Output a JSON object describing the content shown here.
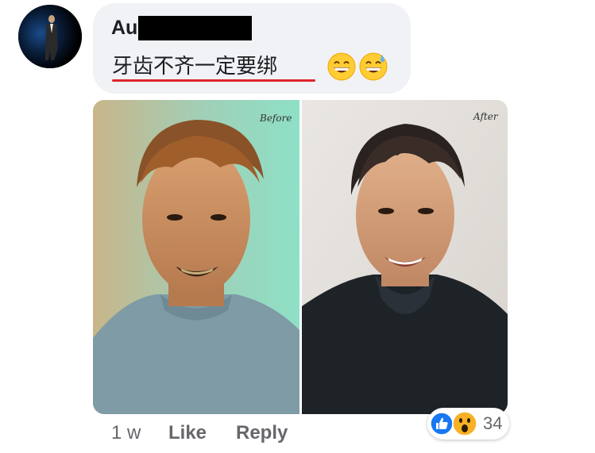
{
  "comment": {
    "author_visible": "Au",
    "text": "牙齿不齐一定要绑",
    "emojis": [
      "grinning-face-with-smiling-eyes",
      "grinning-face-with-sweat"
    ]
  },
  "photo": {
    "left_label": "Before",
    "right_label": "After"
  },
  "footer": {
    "time": "1 w",
    "like": "Like",
    "reply": "Reply"
  },
  "reactions": {
    "types": [
      "like",
      "wow"
    ],
    "count": "34",
    "colors": {
      "like": "#1877f2",
      "wow": "#f7b125"
    }
  }
}
